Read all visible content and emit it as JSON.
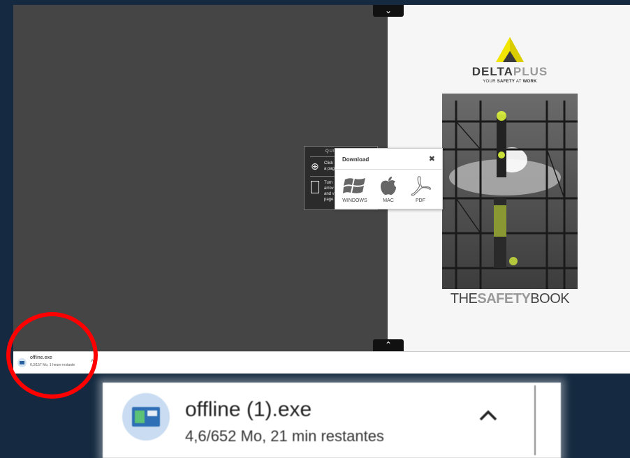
{
  "viewer": {
    "nav_up": "⌄",
    "nav_down": "⌃"
  },
  "brand": {
    "name_part1": "DELTA",
    "name_part2": "PLUS",
    "tagline_part1": "YOUR ",
    "tagline_part2": "SAFETY",
    "tagline_part3": " AT ",
    "tagline_part4": "WORK",
    "colors": {
      "triangle": "#f2e600",
      "dark": "#3c3c3c",
      "grey": "#9a9a9a"
    }
  },
  "book_title": {
    "part1": "THE",
    "part2": "SAFETY",
    "part3": "BOOK"
  },
  "quick_help": {
    "title": "QUI",
    "zoom_icon": "zoom-in-icon",
    "text1_line1": "Click",
    "text1_line2": "a pag",
    "text2_line1": "Turn",
    "text2_line2": "arrov",
    "text2_line3": "and v",
    "text2_line4": "page"
  },
  "download_popup": {
    "title": "Download",
    "close": "✖",
    "options": [
      {
        "label": "WINDOWS",
        "icon": "windows-icon"
      },
      {
        "label": "MAC",
        "icon": "apple-icon"
      },
      {
        "label": "PDF",
        "icon": "pdf-icon"
      }
    ]
  },
  "download_bar_small": {
    "filename": "offline.exe",
    "status": "0,3/157 Mo, 1 heure restante",
    "chevron": "^"
  },
  "download_bar_zoom": {
    "filename": "offline (1).exe",
    "status": "4,6/652 Mo, 21 min restantes",
    "chevron": "^"
  }
}
